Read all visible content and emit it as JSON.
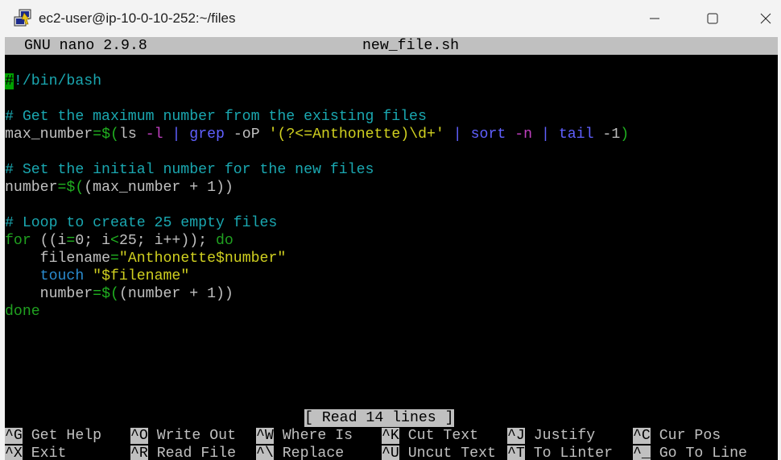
{
  "window": {
    "title": "ec2-user@ip-10-0-10-252:~/files"
  },
  "nano": {
    "version": "GNU nano 2.9.8",
    "filename": "new_file.sh",
    "status": "[ Read 14 lines ]"
  },
  "code": {
    "l1_cursor": "#",
    "l1_rest": "!/bin/bash",
    "l3": "# Get the maximum number from the existing files",
    "l4_var": "max_number",
    "l4_eq": "=",
    "l4_sub": "$(",
    "l4_ls": "ls",
    "l4_l": "-l",
    "l4_pipe1": "|",
    "l4_grep": "grep",
    "l4_oP": "-oP",
    "l4_regex": "'(?<=Anthonette)\\d+'",
    "l4_pipe2": "|",
    "l4_sort": "sort",
    "l4_n": "-n",
    "l4_pipe3": "|",
    "l4_tail": "tail",
    "l4_1": "-1",
    "l4_close": ")",
    "l6": "# Set the initial number for the new files",
    "l7_var": "number",
    "l7_eq": "=",
    "l7_sub": "$(",
    "l7_rest": "(max_number + 1))",
    "l9": "# Loop to create 25 empty files",
    "l10_for": "for",
    "l10_mid1": "((i",
    "l10_eq": "=",
    "l10_mid2": "0; i",
    "l10_lt": "<",
    "l10_mid3": "25; i++)); ",
    "l10_do": "do",
    "l11_var": "filename",
    "l11_eq": "=",
    "l11_str": "\"Anthonette$number\"",
    "l12_touch": "touch",
    "l12_str": "\"$filename\"",
    "l13_var": "number",
    "l13_eq": "=",
    "l13_sub": "$(",
    "l13_rest": "(number + 1))",
    "l14_done": "done"
  },
  "shortcuts": [
    {
      "key": "^G",
      "label": "Get Help"
    },
    {
      "key": "^O",
      "label": "Write Out"
    },
    {
      "key": "^W",
      "label": "Where Is"
    },
    {
      "key": "^K",
      "label": "Cut Text"
    },
    {
      "key": "^J",
      "label": "Justify"
    },
    {
      "key": "^C",
      "label": "Cur Pos"
    },
    {
      "key": "^X",
      "label": "Exit"
    },
    {
      "key": "^R",
      "label": "Read File"
    },
    {
      "key": "^\\",
      "label": "Replace"
    },
    {
      "key": "^U",
      "label": "Uncut Text"
    },
    {
      "key": "^T",
      "label": "To Linter"
    },
    {
      "key": "^_",
      "label": "Go To Line"
    }
  ],
  "icons": {
    "app": "putty-terminal-icon",
    "minimize": "minimize-icon",
    "maximize": "maximize-icon",
    "close": "close-icon"
  }
}
